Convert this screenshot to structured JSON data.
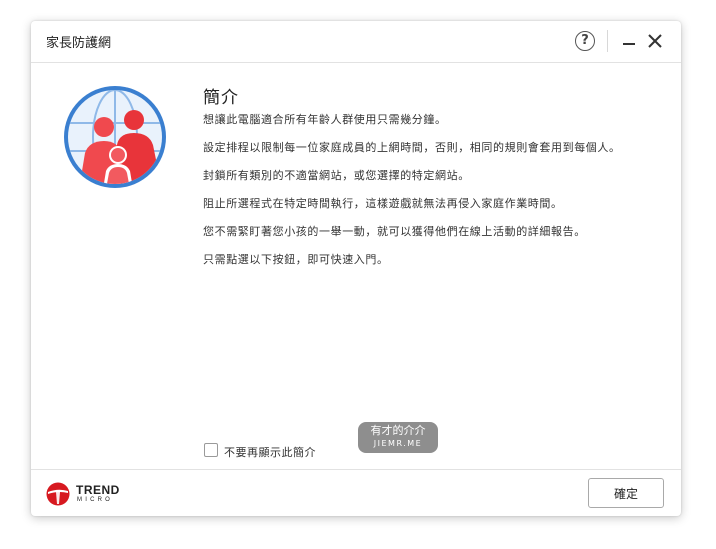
{
  "window": {
    "title": "家長防護網"
  },
  "titlebar": {
    "help_label": "?"
  },
  "content": {
    "heading": "簡介",
    "paragraphs": [
      "想讓此電腦適合所有年齡人群使用只需幾分鐘。",
      "設定排程以限制每一位家庭成員的上網時間，否則，相同的規則會套用到每個人。",
      "封鎖所有類別的不適當網站，或您選擇的特定網站。",
      "阻止所選程式在特定時間執行，這樣遊戲就無法再侵入家庭作業時間。",
      "您不需緊盯著您小孩的一舉一動，就可以獲得他們在線上活動的詳細報告。",
      "只需點選以下按鈕，即可快速入門。"
    ]
  },
  "checkbox": {
    "label": "不要再顯示此簡介",
    "checked": false
  },
  "watermark": {
    "line1": "有才的介介",
    "line2": "JIEMR.ME"
  },
  "footer": {
    "brand": "TREND",
    "brand_sub": "MICRO",
    "ok_label": "確定"
  },
  "colors": {
    "brand_red": "#d71920",
    "illustration_blue": "#4a8fd8",
    "illustration_red": "#e8343a"
  },
  "icons": {
    "help": "question-circle-icon",
    "minimize": "minimize-icon",
    "close": "close-icon",
    "illustration": "family-globe-icon",
    "logo": "trend-micro-logo"
  }
}
